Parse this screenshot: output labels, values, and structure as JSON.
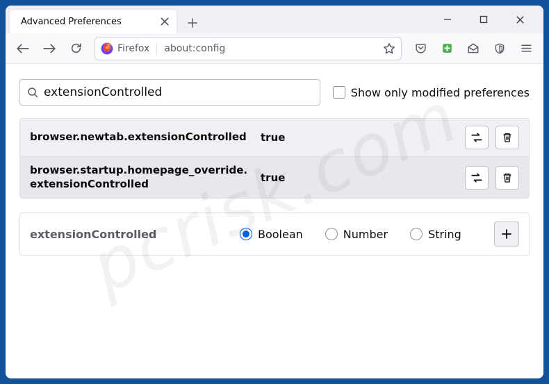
{
  "window": {
    "tab_title": "Advanced Preferences"
  },
  "url_bar": {
    "identity_label": "Firefox",
    "address": "about:config"
  },
  "search": {
    "value": "extensionControlled",
    "show_modified_label": "Show only modified preferences"
  },
  "prefs": [
    {
      "name": "browser.newtab.extensionControlled",
      "value": "true"
    },
    {
      "name": "browser.startup.homepage_override.extensionControlled",
      "value": "true"
    }
  ],
  "new_pref": {
    "name": "extensionControlled",
    "types": [
      "Boolean",
      "Number",
      "String"
    ],
    "selected": "Boolean"
  },
  "watermark": "pcrisk.com"
}
